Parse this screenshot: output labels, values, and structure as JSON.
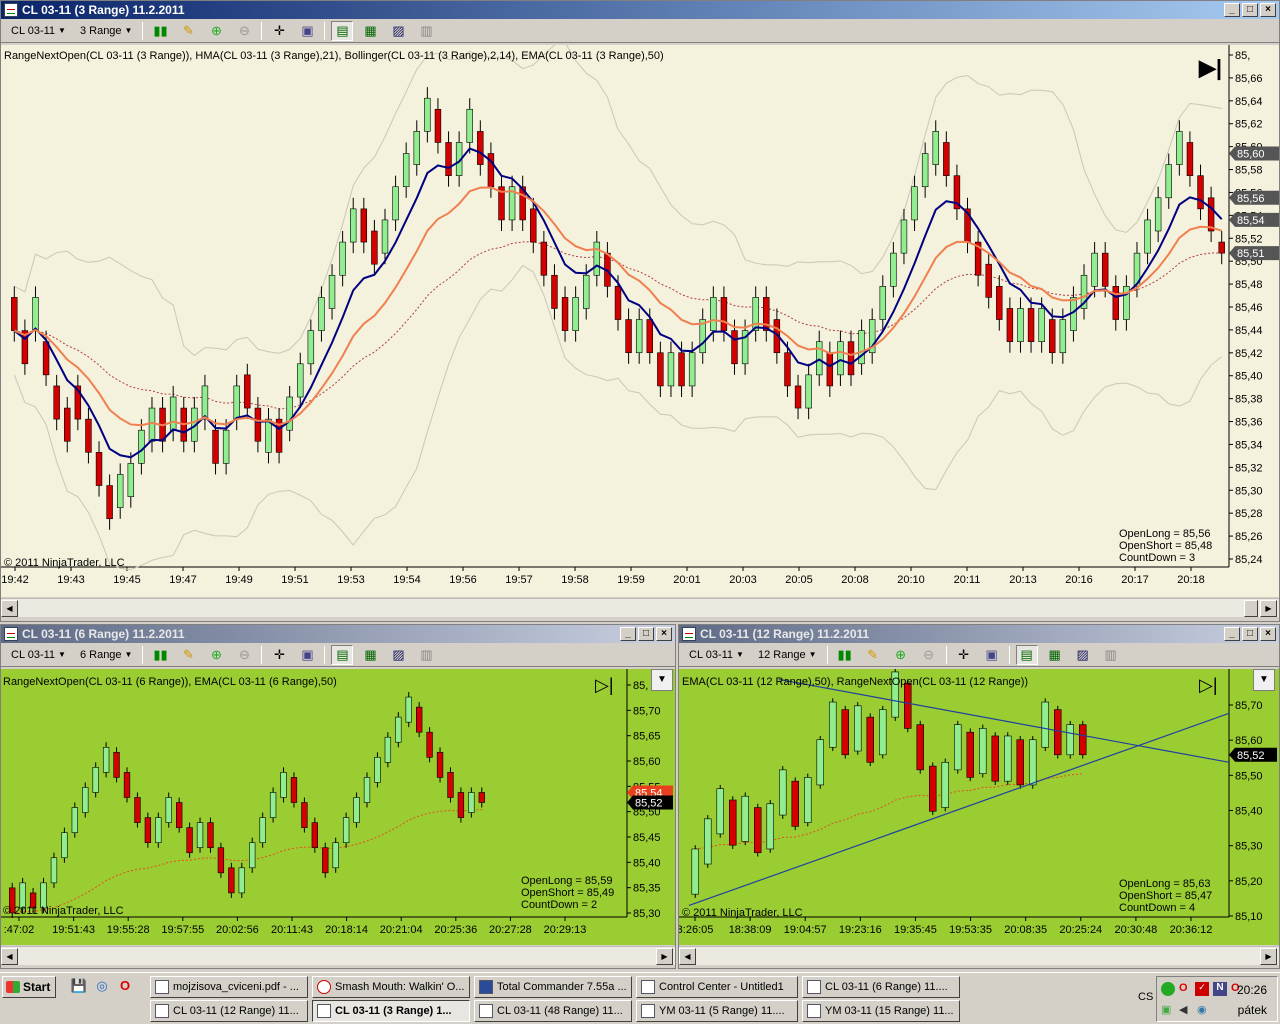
{
  "top_window": {
    "title": "CL 03-11 (3 Range)  11.2.2011",
    "toolbar": {
      "instrument": "CL 03-11",
      "interval": "3 Range"
    },
    "indicator_label": "RangeNextOpen(CL 03-11 (3 Range)), HMA(CL 03-11 (3 Range),21), Bollinger(CL 03-11 (3 Range),2,14), EMA(CL 03-11 (3 Range),50)",
    "copyright": "© 2011 NinjaTrader, LLC",
    "stats": [
      "OpenLong = 85,56",
      "OpenShort = 85,48",
      "CountDown = 3"
    ],
    "price_labels": [
      "85,",
      "85,66",
      "85,64",
      "85,62",
      "85,60",
      "85,58",
      "85,56",
      "85,54",
      "85,52",
      "85,50",
      "85,48",
      "85,46",
      "85,44",
      "85,42",
      "85,40",
      "85,38",
      "85,36",
      "85,34",
      "85,32",
      "85,30",
      "85,28",
      "85,26",
      "85,24"
    ],
    "price_badges": [
      {
        "text": "85,60",
        "value": 85.6,
        "color": "#555555"
      },
      {
        "text": "85,56",
        "value": 85.56,
        "color": "#555555"
      },
      {
        "text": "85,54",
        "value": 85.54,
        "color": "#555555"
      },
      {
        "text": "85,51",
        "value": 85.51,
        "color": "#555555"
      }
    ],
    "time_labels": [
      "19:42",
      "19:43",
      "19:45",
      "19:47",
      "19:49",
      "19:51",
      "19:53",
      "19:54",
      "19:56",
      "19:57",
      "19:58",
      "19:59",
      "20:01",
      "20:03",
      "20:05",
      "20:08",
      "20:10",
      "20:11",
      "20:13",
      "20:16",
      "20:17",
      "20:18"
    ]
  },
  "left_window": {
    "title": "CL 03-11 (6 Range)  11.2.2011",
    "toolbar": {
      "instrument": "CL 03-11",
      "interval": "6 Range"
    },
    "indicator_label": "RangeNextOpen(CL 03-11 (6 Range)), EMA(CL 03-11 (6 Range),50)",
    "copyright": "© 2011 NinjaTrader, LLC",
    "stats": [
      "OpenLong = 85,59",
      "OpenShort = 85,49",
      "CountDown = 2"
    ],
    "price_labels": [
      "85,",
      "85,70",
      "85,65",
      "85,60",
      "85,55",
      "85,50",
      "85,45",
      "85,40",
      "85,35",
      "85,30"
    ],
    "price_badges": [
      {
        "text": "85,54",
        "value": 85.54,
        "color": "#e8401c"
      },
      {
        "text": "85,52",
        "value": 85.52,
        "color": "#000000"
      }
    ],
    "time_labels": [
      ":47:02",
      "19:51:43",
      "19:55:28",
      "19:57:55",
      "20:02:56",
      "20:11:43",
      "20:18:14",
      "20:21:04",
      "20:25:36",
      "20:27:28",
      "20:29:13"
    ]
  },
  "right_window": {
    "title": "CL 03-11 (12 Range)  11.2.2011",
    "toolbar": {
      "instrument": "CL 03-11",
      "interval": "12 Range"
    },
    "indicator_label": "EMA(CL 03-11 (12 Range),50), RangeNextOpen(CL 03-11 (12 Range))",
    "copyright": "© 2011 NinjaTrader, LLC",
    "stats": [
      "OpenLong = 85,63",
      "OpenShort = 85,47",
      "CountDown = 4"
    ],
    "price_labels": [
      "85,70",
      "85,60",
      "85,50",
      "85,40",
      "85,30",
      "85,20",
      "85,10"
    ],
    "price_badges": [
      {
        "text": "85,52",
        "value": 85.52,
        "color": "#000000"
      }
    ],
    "time_labels": [
      "3:26:05",
      "18:38:09",
      "19:04:57",
      "19:23:16",
      "19:35:45",
      "19:53:35",
      "20:08:35",
      "20:25:24",
      "20:30:48",
      "20:36:12"
    ]
  },
  "chart_data": [
    {
      "type": "candlestick",
      "name": "CL 03-11 (3 Range)",
      "ylim": [
        85.23,
        85.68
      ],
      "candles": [
        [
          85.47,
          85.44
        ],
        [
          85.44,
          85.41
        ],
        [
          85.44,
          85.47
        ],
        [
          85.43,
          85.4
        ],
        [
          85.39,
          85.36
        ],
        [
          85.37,
          85.34
        ],
        [
          85.39,
          85.36
        ],
        [
          85.36,
          85.33
        ],
        [
          85.33,
          85.3
        ],
        [
          85.3,
          85.27
        ],
        [
          85.28,
          85.31
        ],
        [
          85.29,
          85.32
        ],
        [
          85.32,
          85.35
        ],
        [
          85.34,
          85.37
        ],
        [
          85.37,
          85.34
        ],
        [
          85.35,
          85.38
        ],
        [
          85.37,
          85.34
        ],
        [
          85.34,
          85.37
        ],
        [
          85.36,
          85.39
        ],
        [
          85.35,
          85.32
        ],
        [
          85.32,
          85.35
        ],
        [
          85.36,
          85.39
        ],
        [
          85.4,
          85.37
        ],
        [
          85.37,
          85.34
        ],
        [
          85.33,
          85.36
        ],
        [
          85.36,
          85.33
        ],
        [
          85.35,
          85.38
        ],
        [
          85.38,
          85.41
        ],
        [
          85.41,
          85.44
        ],
        [
          85.44,
          85.47
        ],
        [
          85.46,
          85.49
        ],
        [
          85.49,
          85.52
        ],
        [
          85.52,
          85.55
        ],
        [
          85.55,
          85.52
        ],
        [
          85.53,
          85.5
        ],
        [
          85.51,
          85.54
        ],
        [
          85.54,
          85.57
        ],
        [
          85.57,
          85.6
        ],
        [
          85.59,
          85.62
        ],
        [
          85.62,
          85.65
        ],
        [
          85.64,
          85.61
        ],
        [
          85.61,
          85.58
        ],
        [
          85.58,
          85.61
        ],
        [
          85.61,
          85.64
        ],
        [
          85.62,
          85.59
        ],
        [
          85.6,
          85.57
        ],
        [
          85.57,
          85.54
        ],
        [
          85.54,
          85.57
        ],
        [
          85.57,
          85.54
        ],
        [
          85.55,
          85.52
        ],
        [
          85.52,
          85.49
        ],
        [
          85.49,
          85.46
        ],
        [
          85.47,
          85.44
        ],
        [
          85.44,
          85.47
        ],
        [
          85.46,
          85.49
        ],
        [
          85.49,
          85.52
        ],
        [
          85.51,
          85.48
        ],
        [
          85.48,
          85.45
        ],
        [
          85.45,
          85.42
        ],
        [
          85.42,
          85.45
        ],
        [
          85.45,
          85.42
        ],
        [
          85.42,
          85.39
        ],
        [
          85.39,
          85.42
        ],
        [
          85.42,
          85.39
        ],
        [
          85.39,
          85.42
        ],
        [
          85.42,
          85.45
        ],
        [
          85.44,
          85.47
        ],
        [
          85.47,
          85.44
        ],
        [
          85.44,
          85.41
        ],
        [
          85.41,
          85.44
        ],
        [
          85.44,
          85.47
        ],
        [
          85.47,
          85.44
        ],
        [
          85.45,
          85.42
        ],
        [
          85.42,
          85.39
        ],
        [
          85.39,
          85.37
        ],
        [
          85.37,
          85.4
        ],
        [
          85.4,
          85.43
        ],
        [
          85.42,
          85.39
        ],
        [
          85.4,
          85.43
        ],
        [
          85.43,
          85.4
        ],
        [
          85.41,
          85.44
        ],
        [
          85.42,
          85.45
        ],
        [
          85.45,
          85.48
        ],
        [
          85.48,
          85.51
        ],
        [
          85.51,
          85.54
        ],
        [
          85.54,
          85.57
        ],
        [
          85.57,
          85.6
        ],
        [
          85.59,
          85.62
        ],
        [
          85.61,
          85.58
        ],
        [
          85.58,
          85.55
        ],
        [
          85.55,
          85.52
        ],
        [
          85.52,
          85.49
        ],
        [
          85.5,
          85.47
        ],
        [
          85.48,
          85.45
        ],
        [
          85.46,
          85.43
        ],
        [
          85.43,
          85.46
        ],
        [
          85.46,
          85.43
        ],
        [
          85.43,
          85.46
        ],
        [
          85.45,
          85.42
        ],
        [
          85.42,
          85.45
        ],
        [
          85.44,
          85.47
        ],
        [
          85.46,
          85.49
        ],
        [
          85.48,
          85.51
        ],
        [
          85.51,
          85.48
        ],
        [
          85.48,
          85.45
        ],
        [
          85.45,
          85.48
        ],
        [
          85.48,
          85.51
        ],
        [
          85.51,
          85.54
        ],
        [
          85.53,
          85.56
        ],
        [
          85.56,
          85.59
        ],
        [
          85.59,
          85.62
        ],
        [
          85.61,
          85.58
        ],
        [
          85.58,
          85.55
        ],
        [
          85.56,
          85.53
        ],
        [
          85.52,
          85.51
        ]
      ]
    },
    {
      "type": "candlestick",
      "name": "CL 03-11 (6 Range)",
      "ylim": [
        85.3,
        85.75
      ],
      "candles": [
        [
          85.35,
          85.3
        ],
        [
          85.31,
          85.36
        ],
        [
          85.34,
          85.31
        ],
        [
          85.31,
          85.36
        ],
        [
          85.36,
          85.41
        ],
        [
          85.41,
          85.46
        ],
        [
          85.46,
          85.51
        ],
        [
          85.5,
          85.55
        ],
        [
          85.54,
          85.59
        ],
        [
          85.58,
          85.63
        ],
        [
          85.62,
          85.57
        ],
        [
          85.58,
          85.53
        ],
        [
          85.53,
          85.48
        ],
        [
          85.49,
          85.44
        ],
        [
          85.44,
          85.49
        ],
        [
          85.48,
          85.53
        ],
        [
          85.52,
          85.47
        ],
        [
          85.47,
          85.42
        ],
        [
          85.43,
          85.48
        ],
        [
          85.48,
          85.43
        ],
        [
          85.43,
          85.38
        ],
        [
          85.39,
          85.34
        ],
        [
          85.34,
          85.39
        ],
        [
          85.39,
          85.44
        ],
        [
          85.44,
          85.49
        ],
        [
          85.49,
          85.54
        ],
        [
          85.53,
          85.58
        ],
        [
          85.57,
          85.52
        ],
        [
          85.52,
          85.47
        ],
        [
          85.48,
          85.43
        ],
        [
          85.43,
          85.38
        ],
        [
          85.39,
          85.44
        ],
        [
          85.44,
          85.49
        ],
        [
          85.48,
          85.53
        ],
        [
          85.52,
          85.57
        ],
        [
          85.56,
          85.61
        ],
        [
          85.6,
          85.65
        ],
        [
          85.64,
          85.69
        ],
        [
          85.68,
          85.73
        ],
        [
          85.71,
          85.66
        ],
        [
          85.66,
          85.61
        ],
        [
          85.62,
          85.57
        ],
        [
          85.58,
          85.53
        ],
        [
          85.54,
          85.49
        ],
        [
          85.5,
          85.54
        ],
        [
          85.54,
          85.52
        ]
      ]
    },
    {
      "type": "candlestick",
      "name": "CL 03-11 (12 Range)",
      "ylim": [
        85.1,
        85.7
      ],
      "candles": [
        [
          85.15,
          85.27
        ],
        [
          85.23,
          85.35
        ],
        [
          85.31,
          85.43
        ],
        [
          85.4,
          85.28
        ],
        [
          85.29,
          85.41
        ],
        [
          85.38,
          85.26
        ],
        [
          85.27,
          85.39
        ],
        [
          85.36,
          85.48
        ],
        [
          85.45,
          85.33
        ],
        [
          85.34,
          85.46
        ],
        [
          85.44,
          85.56
        ],
        [
          85.54,
          85.66
        ],
        [
          85.64,
          85.52
        ],
        [
          85.53,
          85.65
        ],
        [
          85.62,
          85.5
        ],
        [
          85.52,
          85.64
        ],
        [
          85.62,
          85.74
        ],
        [
          85.71,
          85.59
        ],
        [
          85.6,
          85.48
        ],
        [
          85.49,
          85.37
        ],
        [
          85.38,
          85.5
        ],
        [
          85.48,
          85.6
        ],
        [
          85.58,
          85.46
        ],
        [
          85.47,
          85.59
        ],
        [
          85.57,
          85.45
        ],
        [
          85.45,
          85.57
        ],
        [
          85.56,
          85.44
        ],
        [
          85.44,
          85.56
        ],
        [
          85.54,
          85.66
        ],
        [
          85.64,
          85.52
        ],
        [
          85.52,
          85.6
        ],
        [
          85.6,
          85.52
        ]
      ]
    }
  ]
}
